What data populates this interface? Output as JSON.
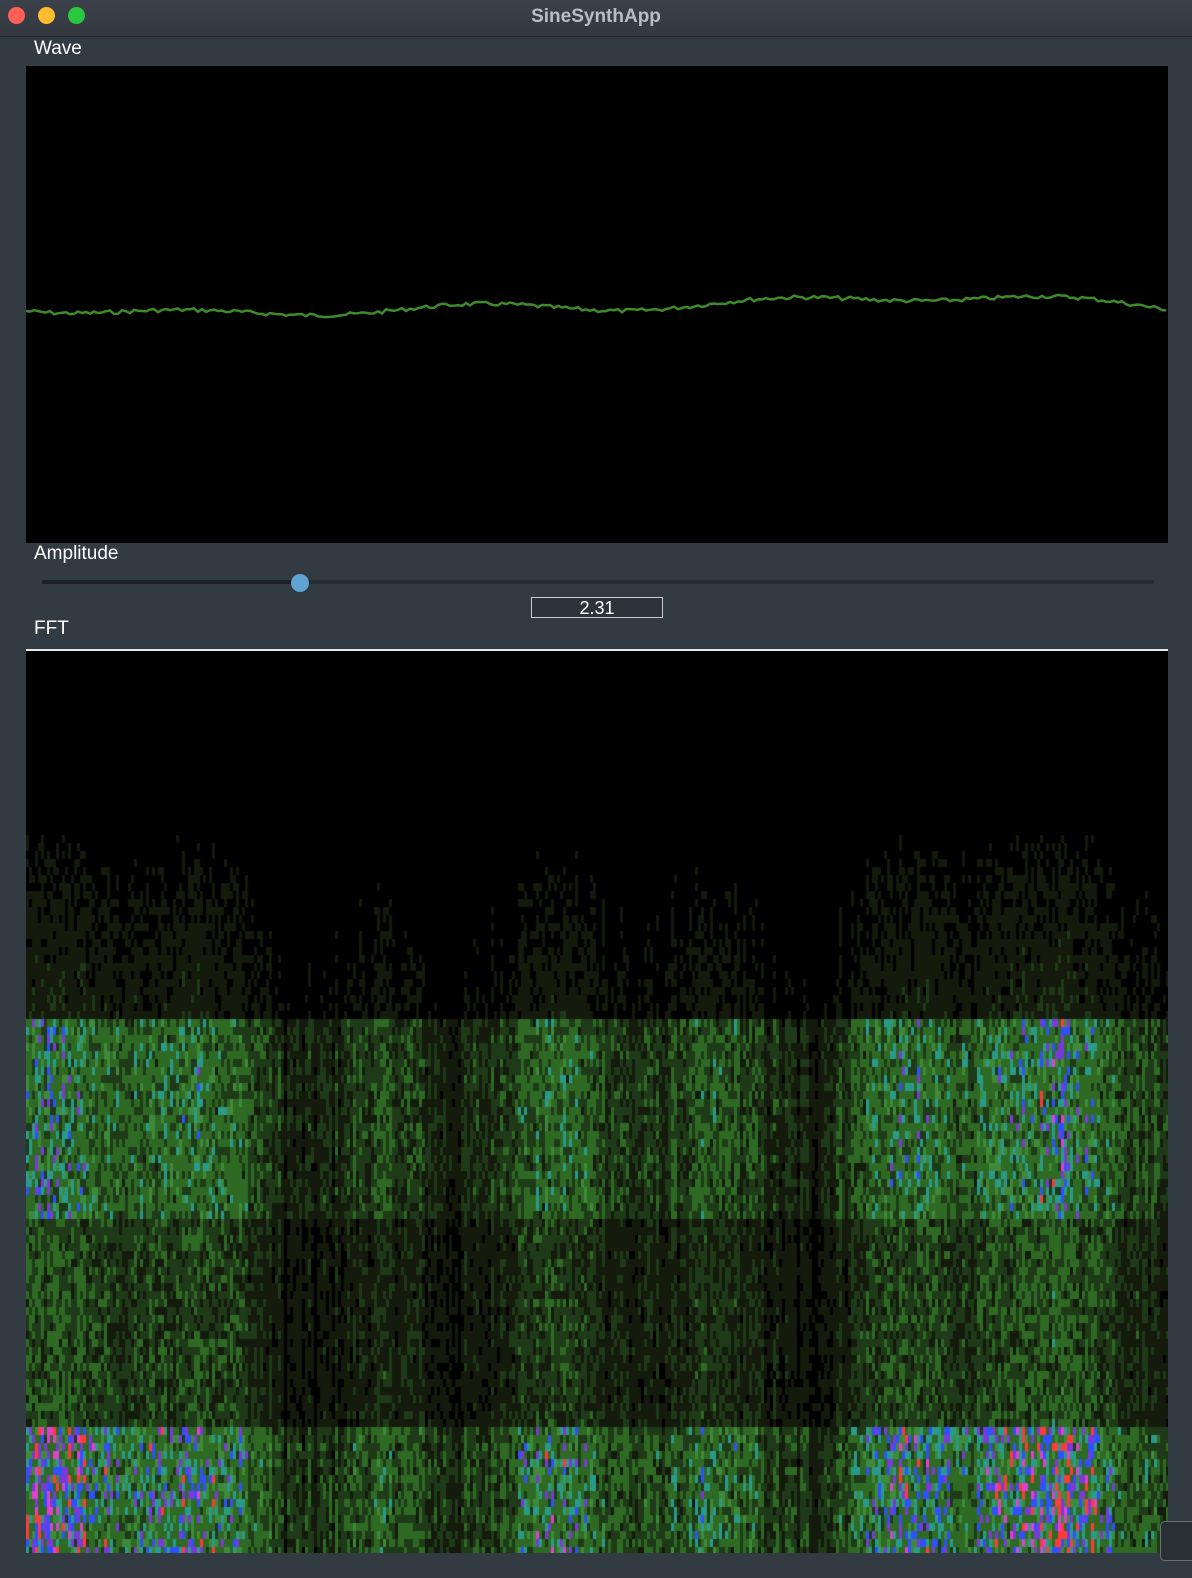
{
  "window": {
    "title": "SineSynthApp"
  },
  "wave": {
    "label": "Wave",
    "colors": {
      "background": "#000000",
      "line": "#3f8a2a"
    }
  },
  "amplitude": {
    "label": "Amplitude",
    "value": "2.31",
    "slider_fraction": 0.232,
    "colors": {
      "thumb": "#5fa4d3"
    }
  },
  "fft": {
    "label": "FFT",
    "colors": {
      "background": "#000000",
      "low": "#3a7a2a",
      "mid": "#2a9a8a",
      "peak": "#ff3030",
      "alt": "#3040ff"
    }
  }
}
